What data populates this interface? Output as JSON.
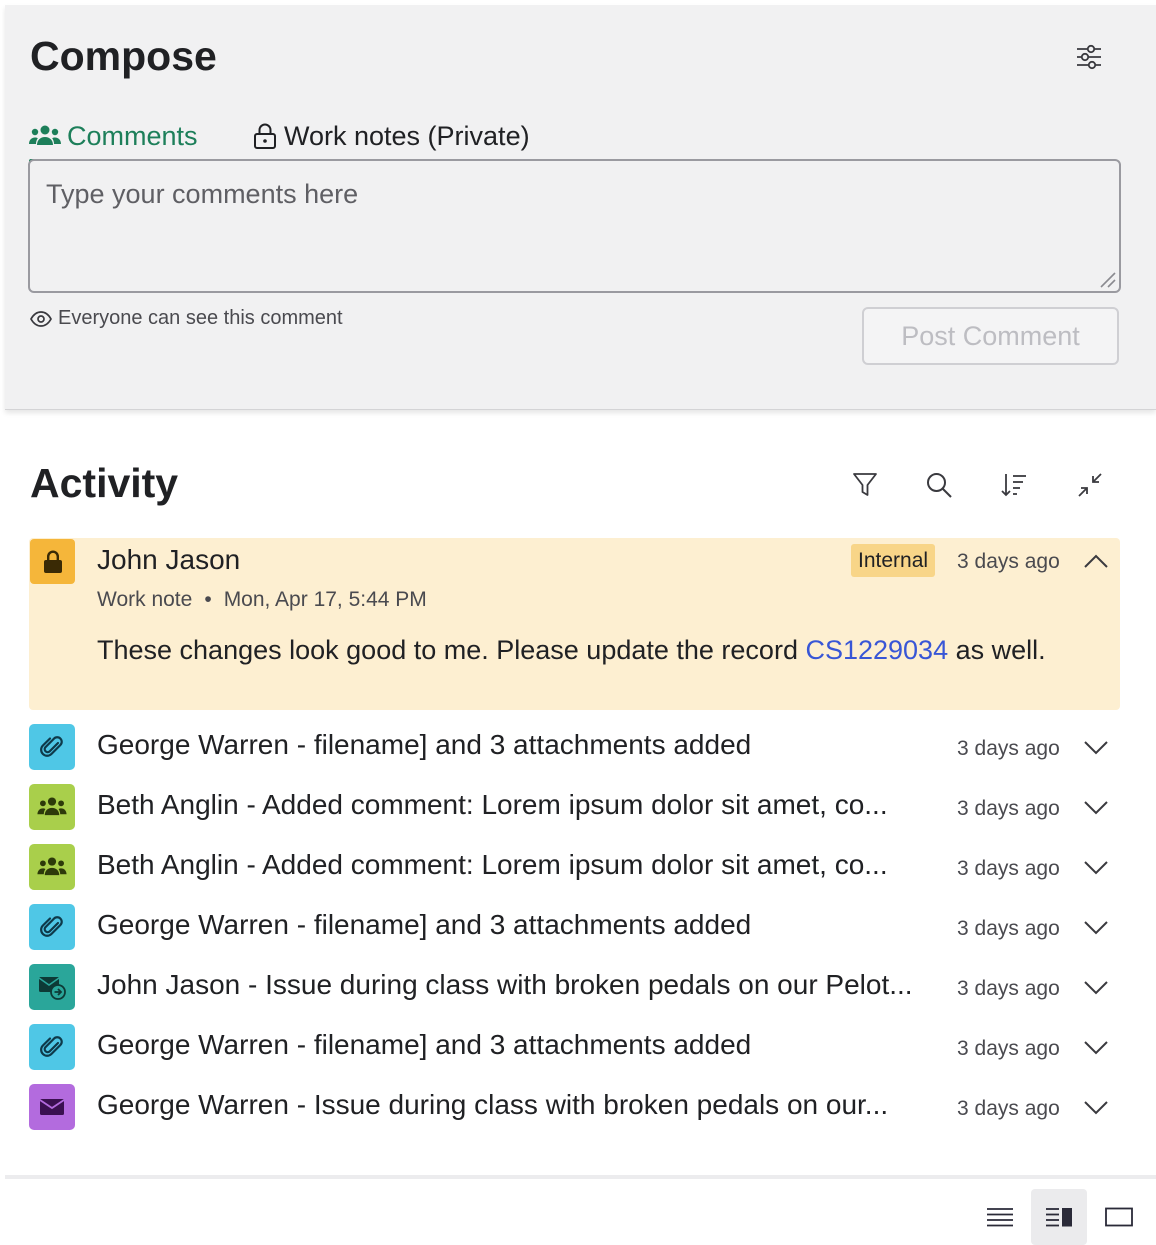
{
  "compose": {
    "title": "Compose",
    "tabs": [
      {
        "label": "Comments",
        "icon": "people-icon",
        "active": true
      },
      {
        "label": "Work notes (Private)",
        "icon": "lock-icon",
        "active": false
      }
    ],
    "placeholder": "Type your comments here",
    "visibility_note": "Everyone can see this comment",
    "post_button": "Post Comment",
    "accent_color": "#1d7f5a"
  },
  "activity": {
    "title": "Activity",
    "featured": {
      "name": "John Jason",
      "badge": "Internal",
      "time": "3 days ago",
      "type": "Work note",
      "separator": "•",
      "date": "Mon, Apr 17, 5:44 PM",
      "body_before": "These changes look good to me. Please update the record ",
      "link": "CS1229034",
      "body_after": " as well.",
      "icon": "lock-icon",
      "icon_color": "#f5b63a",
      "background": "#fdefd1"
    },
    "items": [
      {
        "author": "George Warren",
        "text": " - filename] and 3 attachments added",
        "time": "3 days ago",
        "icon": "paperclip-icon",
        "color": "#4fc7e6"
      },
      {
        "author": "Beth Anglin",
        "text": " - Added comment: Lorem ipsum dolor sit amet, co...",
        "time": "3 days ago",
        "icon": "people-icon",
        "color": "#a9cf4b"
      },
      {
        "author": "Beth Anglin",
        "text": " - Added comment: Lorem ipsum dolor sit amet, co...",
        "time": "3 days ago",
        "icon": "people-icon",
        "color": "#a9cf4b"
      },
      {
        "author": "George Warren",
        "text": " - filename] and 3 attachments added",
        "time": "3 days ago",
        "icon": "paperclip-icon",
        "color": "#4fc7e6"
      },
      {
        "author": "John Jason",
        "text": " - Issue during class with broken pedals on our Pelot...",
        "time": "3 days ago",
        "icon": "email-forward-icon",
        "color": "#2aa69a"
      },
      {
        "author": "George Warren",
        "text": " - filename] and 3 attachments added",
        "time": "3 days ago",
        "icon": "paperclip-icon",
        "color": "#4fc7e6"
      },
      {
        "author": "George Warren",
        "text": " - Issue during class with broken pedals on our...",
        "time": "3 days ago",
        "icon": "envelope-icon",
        "color": "#b36bde"
      }
    ]
  },
  "footer": {
    "views": [
      "list-view-icon",
      "split-view-icon",
      "single-view-icon"
    ],
    "active_view": "split-view-icon"
  }
}
